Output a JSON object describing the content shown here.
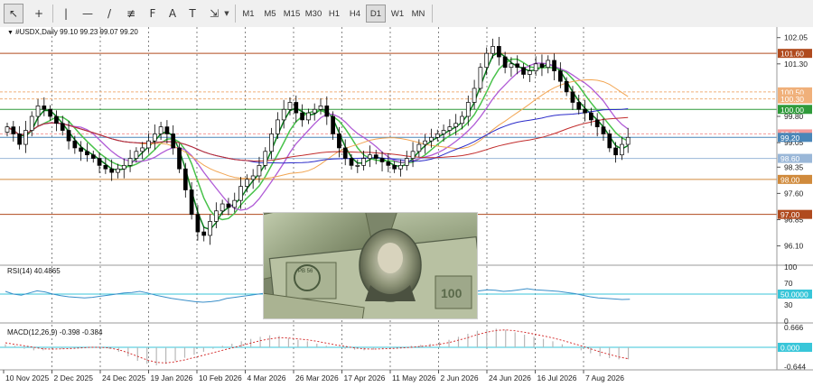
{
  "toolbar": {
    "tools": [
      {
        "name": "cursor-icon",
        "label": "↖"
      },
      {
        "name": "crosshair-icon",
        "label": "+"
      },
      {
        "name": "vertical-line-icon",
        "label": "|"
      },
      {
        "name": "horizontal-line-icon",
        "label": "—"
      },
      {
        "name": "trend-line-icon",
        "label": "/"
      },
      {
        "name": "channel-icon",
        "label": "≢"
      },
      {
        "name": "fibonacci-icon",
        "label": "F"
      },
      {
        "name": "text-icon",
        "label": "A"
      },
      {
        "name": "text-label-icon",
        "label": "T"
      },
      {
        "name": "shapes-icon",
        "label": "⇲"
      }
    ],
    "timeframes": [
      "M1",
      "M5",
      "M15",
      "M30",
      "H1",
      "H4",
      "D1",
      "W1",
      "MN"
    ],
    "active_timeframe": "D1"
  },
  "chart_header": {
    "symbol_line": "#USDX,Daily  99.10 99.23 99.07 99.20"
  },
  "price_axis": {
    "ticks": [
      "102.05",
      "101.30",
      "99.80",
      "99.05",
      "98.35",
      "97.60",
      "96.85",
      "96.10"
    ],
    "level_labels": [
      {
        "text": "101.60",
        "value": 101.6,
        "color": "#b04a1e"
      },
      {
        "text": "100.50",
        "value": 100.5,
        "color": "#f0b07a"
      },
      {
        "text": "100.30",
        "value": 100.3,
        "color": "#f0b07a"
      },
      {
        "text": "100.00",
        "value": 100.0,
        "color": "#2e9a3a"
      },
      {
        "text": "99.30",
        "value": 99.3,
        "color": "#f29a9a"
      },
      {
        "text": "99.20",
        "value": 99.2,
        "color": "#4a86b8"
      },
      {
        "text": "98.60",
        "value": 98.6,
        "color": "#9ab7d8"
      },
      {
        "text": "98.00",
        "value": 98.0,
        "color": "#d08a3c"
      },
      {
        "text": "97.00",
        "value": 97.0,
        "color": "#b04a1e"
      }
    ]
  },
  "rsi": {
    "label": "RSI(14) 40.4865",
    "ticks": [
      "100",
      "70",
      "30",
      "0"
    ],
    "level_label": "50.0000",
    "level_color": "#38c6d9"
  },
  "macd": {
    "label": "MACD(12,26,9) -0.398 -0.384",
    "ticks": [
      "0.666",
      "-0.644"
    ],
    "level_label": "0.000",
    "level_color": "#38c6d9"
  },
  "time_axis": {
    "labels": [
      "10 Nov 2025",
      "2 Dec 2025",
      "24 Dec 2025",
      "19 Jan 2026",
      "10 Feb 2026",
      "4 Mar 2026",
      "26 Mar 2026",
      "17 Apr 2026",
      "11 May 2026",
      "2 Jun 2026",
      "24 Jun 2026",
      "16 Jul 2026",
      "7 Aug 2026"
    ]
  },
  "chart_data": {
    "type": "candlestick",
    "symbol": "#USDX",
    "timeframe": "Daily",
    "ohlc_last": {
      "open": 99.1,
      "high": 99.23,
      "low": 99.07,
      "close": 99.2
    },
    "ylim": [
      95.6,
      102.3
    ],
    "close": [
      99.5,
      99.3,
      99.0,
      99.4,
      99.8,
      100.1,
      100.0,
      99.8,
      99.6,
      99.4,
      99.1,
      98.9,
      98.8,
      98.7,
      98.6,
      98.4,
      98.3,
      98.2,
      98.3,
      98.4,
      98.6,
      98.8,
      98.9,
      99.1,
      99.3,
      99.5,
      99.3,
      98.9,
      98.3,
      97.7,
      97.0,
      96.5,
      96.4,
      96.8,
      97.1,
      97.3,
      97.2,
      97.4,
      97.8,
      98.0,
      98.1,
      98.4,
      98.8,
      99.3,
      99.7,
      100.0,
      100.2,
      99.9,
      99.7,
      99.9,
      100.0,
      100.1,
      99.8,
      99.3,
      98.9,
      98.6,
      98.4,
      98.4,
      98.6,
      98.7,
      98.6,
      98.5,
      98.4,
      98.3,
      98.4,
      98.6,
      98.8,
      99.0,
      99.1,
      99.2,
      99.3,
      99.4,
      99.5,
      99.6,
      99.8,
      100.2,
      100.6,
      101.2,
      101.6,
      101.8,
      101.5,
      101.2,
      101.3,
      101.2,
      101.0,
      101.1,
      101.3,
      101.2,
      101.4,
      101.1,
      100.8,
      100.5,
      100.2,
      100.0,
      99.9,
      99.7,
      99.5,
      99.3,
      98.9,
      98.7,
      99.0,
      99.2
    ],
    "rsi_values": [
      55,
      50,
      48,
      52,
      56,
      54,
      50,
      47,
      45,
      44,
      43,
      44,
      46,
      48,
      50,
      52,
      53,
      55,
      52,
      48,
      45,
      42,
      40,
      38,
      36,
      35,
      36,
      38,
      42,
      44,
      46,
      48,
      50,
      52,
      51,
      50,
      49,
      50,
      48,
      47,
      46,
      45,
      46,
      47,
      48,
      49,
      50,
      52,
      55,
      57,
      58,
      56,
      54,
      55,
      57,
      58,
      56,
      54,
      52,
      54,
      56,
      58,
      57,
      55,
      56,
      58,
      60,
      58,
      57,
      56,
      55,
      53,
      51,
      48,
      45,
      43,
      42,
      41,
      40,
      40.5
    ],
    "rsi_ylim": [
      0,
      100
    ],
    "rsi_level": 50,
    "macd_hist": [
      0.1,
      0.05,
      -0.05,
      -0.1,
      -0.1,
      -0.08,
      -0.05,
      -0.02,
      0.0,
      0.02,
      0.0,
      -0.05,
      -0.15,
      -0.3,
      -0.45,
      -0.55,
      -0.6,
      -0.55,
      -0.45,
      -0.35,
      -0.25,
      -0.15,
      -0.05,
      0.05,
      0.12,
      0.2,
      0.28,
      0.35,
      0.4,
      0.38,
      0.3,
      0.25,
      0.2,
      0.12,
      0.05,
      0.0,
      -0.05,
      -0.08,
      -0.1,
      -0.08,
      -0.05,
      -0.02,
      0.02,
      0.05,
      0.08,
      0.12,
      0.18,
      0.25,
      0.35,
      0.45,
      0.55,
      0.6,
      0.62,
      0.58,
      0.5,
      0.42,
      0.35,
      0.28,
      0.2,
      0.1,
      0.0,
      -0.1,
      -0.2,
      -0.3,
      -0.36,
      -0.4,
      -0.4
    ],
    "macd_signal": [
      0.15,
      0.1,
      0.05,
      0.0,
      -0.05,
      -0.06,
      -0.05,
      -0.04,
      -0.02,
      0.0,
      0.0,
      -0.02,
      -0.08,
      -0.18,
      -0.3,
      -0.42,
      -0.5,
      -0.52,
      -0.48,
      -0.42,
      -0.34,
      -0.26,
      -0.18,
      -0.1,
      -0.02,
      0.06,
      0.14,
      0.22,
      0.28,
      0.32,
      0.31,
      0.28,
      0.25,
      0.2,
      0.14,
      0.08,
      0.03,
      -0.02,
      -0.05,
      -0.06,
      -0.05,
      -0.04,
      -0.02,
      0.0,
      0.03,
      0.06,
      0.1,
      0.16,
      0.24,
      0.32,
      0.42,
      0.5,
      0.56,
      0.58,
      0.55,
      0.5,
      0.44,
      0.38,
      0.31,
      0.23,
      0.14,
      0.05,
      -0.05,
      -0.15,
      -0.24,
      -0.32,
      -0.38
    ],
    "macd_ylim": [
      -0.75,
      0.75
    ]
  }
}
